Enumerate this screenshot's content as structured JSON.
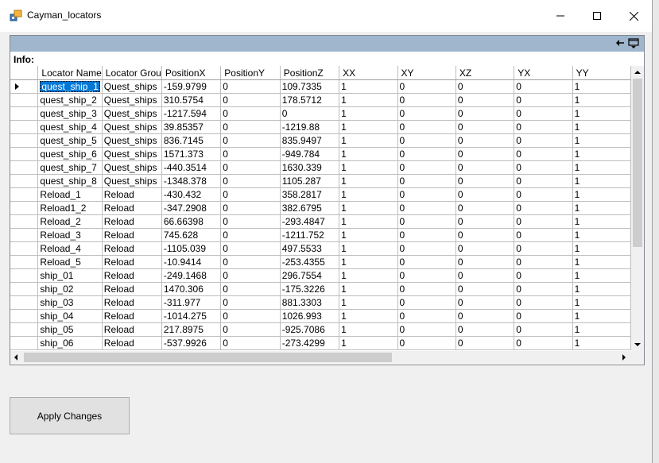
{
  "window": {
    "title": "Cayman_locators"
  },
  "info_label": "Info:",
  "columns": [
    "Locator Name",
    "Locator Grou",
    "PositionX",
    "PositionY",
    "PositionZ",
    "XX",
    "XY",
    "XZ",
    "YX",
    "YY"
  ],
  "rows": [
    [
      "quest_ship_1",
      "Quest_ships",
      "-159.9799",
      "0",
      "109.7335",
      "1",
      "0",
      "0",
      "0",
      "1"
    ],
    [
      "quest_ship_2",
      "Quest_ships",
      "310.5754",
      "0",
      "178.5712",
      "1",
      "0",
      "0",
      "0",
      "1"
    ],
    [
      "quest_ship_3",
      "Quest_ships",
      "-1217.594",
      "0",
      "0",
      "1",
      "0",
      "0",
      "0",
      "1"
    ],
    [
      "quest_ship_4",
      "Quest_ships",
      "39.85357",
      "0",
      "-1219.88",
      "1",
      "0",
      "0",
      "0",
      "1"
    ],
    [
      "quest_ship_5",
      "Quest_ships",
      "836.7145",
      "0",
      "835.9497",
      "1",
      "0",
      "0",
      "0",
      "1"
    ],
    [
      "quest_ship_6",
      "Quest_ships",
      "1571.373",
      "0",
      "-949.784",
      "1",
      "0",
      "0",
      "0",
      "1"
    ],
    [
      "quest_ship_7",
      "Quest_ships",
      "-440.3514",
      "0",
      "1630.339",
      "1",
      "0",
      "0",
      "0",
      "1"
    ],
    [
      "quest_ship_8",
      "Quest_ships",
      "-1348.378",
      "0",
      "1105.287",
      "1",
      "0",
      "0",
      "0",
      "1"
    ],
    [
      "Reload_1",
      "Reload",
      "-430.432",
      "0",
      "358.2817",
      "1",
      "0",
      "0",
      "0",
      "1"
    ],
    [
      "Reload1_2",
      "Reload",
      "-347.2908",
      "0",
      "382.6795",
      "1",
      "0",
      "0",
      "0",
      "1"
    ],
    [
      "Reload_2",
      "Reload",
      "66.66398",
      "0",
      "-293.4847",
      "1",
      "0",
      "0",
      "0",
      "1"
    ],
    [
      "Reload_3",
      "Reload",
      "745.628",
      "0",
      "-1211.752",
      "1",
      "0",
      "0",
      "0",
      "1"
    ],
    [
      "Reload_4",
      "Reload",
      "-1105.039",
      "0",
      "497.5533",
      "1",
      "0",
      "0",
      "0",
      "1"
    ],
    [
      "Reload_5",
      "Reload",
      "-10.9414",
      "0",
      "-253.4355",
      "1",
      "0",
      "0",
      "0",
      "1"
    ],
    [
      "ship_01",
      "Reload",
      "-249.1468",
      "0",
      "296.7554",
      "1",
      "0",
      "0",
      "0",
      "1"
    ],
    [
      "ship_02",
      "Reload",
      "1470.306",
      "0",
      "-175.3226",
      "1",
      "0",
      "0",
      "0",
      "1"
    ],
    [
      "ship_03",
      "Reload",
      "-311.977",
      "0",
      "881.3303",
      "1",
      "0",
      "0",
      "0",
      "1"
    ],
    [
      "ship_04",
      "Reload",
      "-1014.275",
      "0",
      "1026.993",
      "1",
      "0",
      "0",
      "0",
      "1"
    ],
    [
      "ship_05",
      "Reload",
      "217.8975",
      "0",
      "-925.7086",
      "1",
      "0",
      "0",
      "0",
      "1"
    ],
    [
      "ship_06",
      "Reload",
      "-537.9926",
      "0",
      "-273.4299",
      "1",
      "0",
      "0",
      "0",
      "1"
    ]
  ],
  "selected_row": 0,
  "buttons": {
    "apply": "Apply Changes"
  },
  "colors": {
    "selection": "#0078d7",
    "toolstrip": "#9fb6cd"
  },
  "icons": [
    "app-icon",
    "minimize-icon",
    "maximize-icon",
    "close-icon",
    "pin-icon",
    "dock-icon"
  ]
}
